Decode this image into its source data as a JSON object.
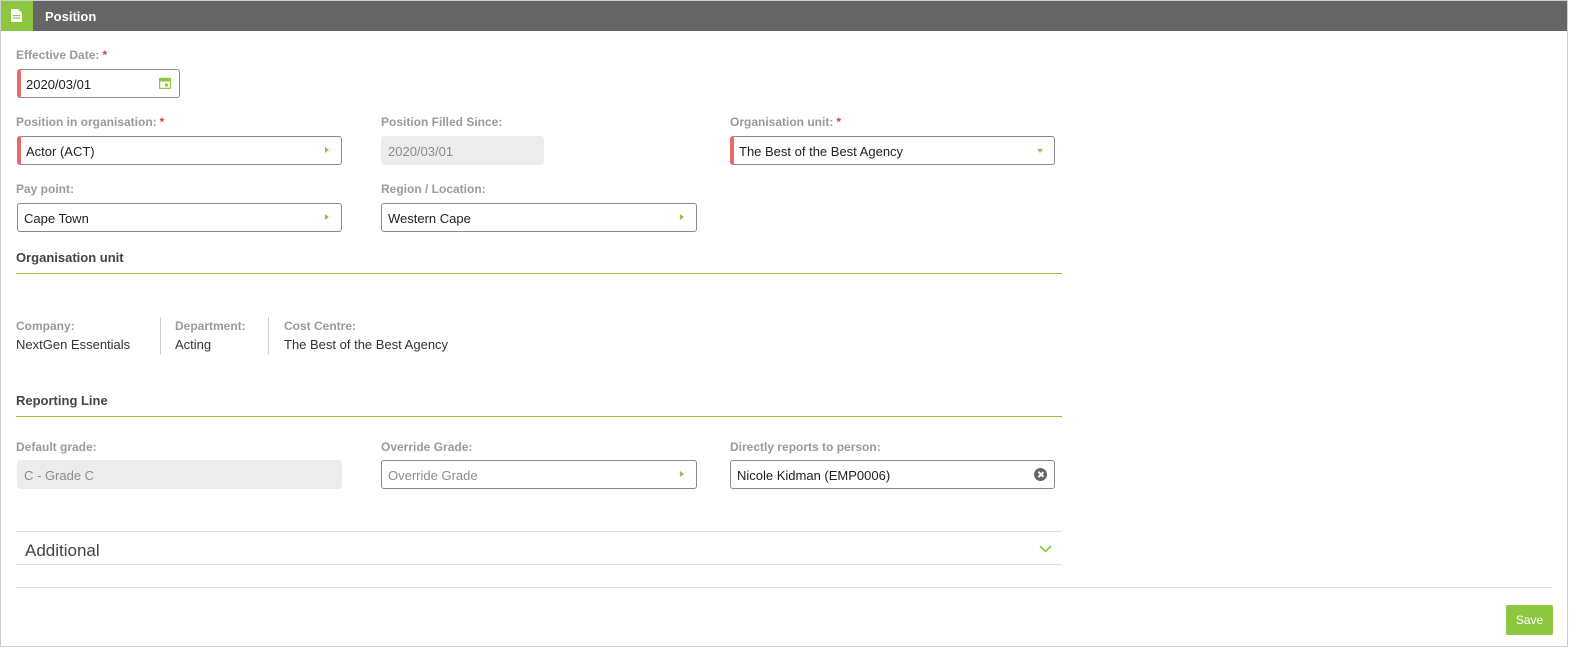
{
  "header": {
    "title": "Position",
    "icon": "document-icon"
  },
  "required_marker": "*",
  "effective_date": {
    "label": "Effective Date:",
    "value": "2020/03/01"
  },
  "position_in_organisation": {
    "label": "Position in organisation:",
    "value": "Actor (ACT)"
  },
  "position_filled_since": {
    "label": "Position Filled Since:",
    "value": "2020/03/01"
  },
  "organisation_unit_field": {
    "label": "Organisation unit:",
    "value": "The Best of the Best Agency"
  },
  "pay_point": {
    "label": "Pay point:",
    "value": "Cape Town"
  },
  "region_location": {
    "label": "Region / Location:",
    "value": "Western Cape"
  },
  "organisation_unit_section": {
    "title": "Organisation unit",
    "company": {
      "label": "Company:",
      "value": "NextGen Essentials"
    },
    "department": {
      "label": "Department:",
      "value": "Acting"
    },
    "cost_centre": {
      "label": "Cost Centre:",
      "value": "The Best of the Best Agency"
    }
  },
  "reporting_line": {
    "title": "Reporting Line",
    "default_grade": {
      "label": "Default grade:",
      "value": "C - Grade C"
    },
    "override_grade": {
      "label": "Override Grade:",
      "placeholder": "Override Grade"
    },
    "directly_reports_to": {
      "label": "Directly reports to person:",
      "value": "Nicole Kidman (EMP0006)"
    }
  },
  "additional": {
    "title": "Additional"
  },
  "save_label": "Save",
  "colors": {
    "accent": "#8dc63f",
    "header_bg": "#666666",
    "required": "#e86a6a"
  }
}
